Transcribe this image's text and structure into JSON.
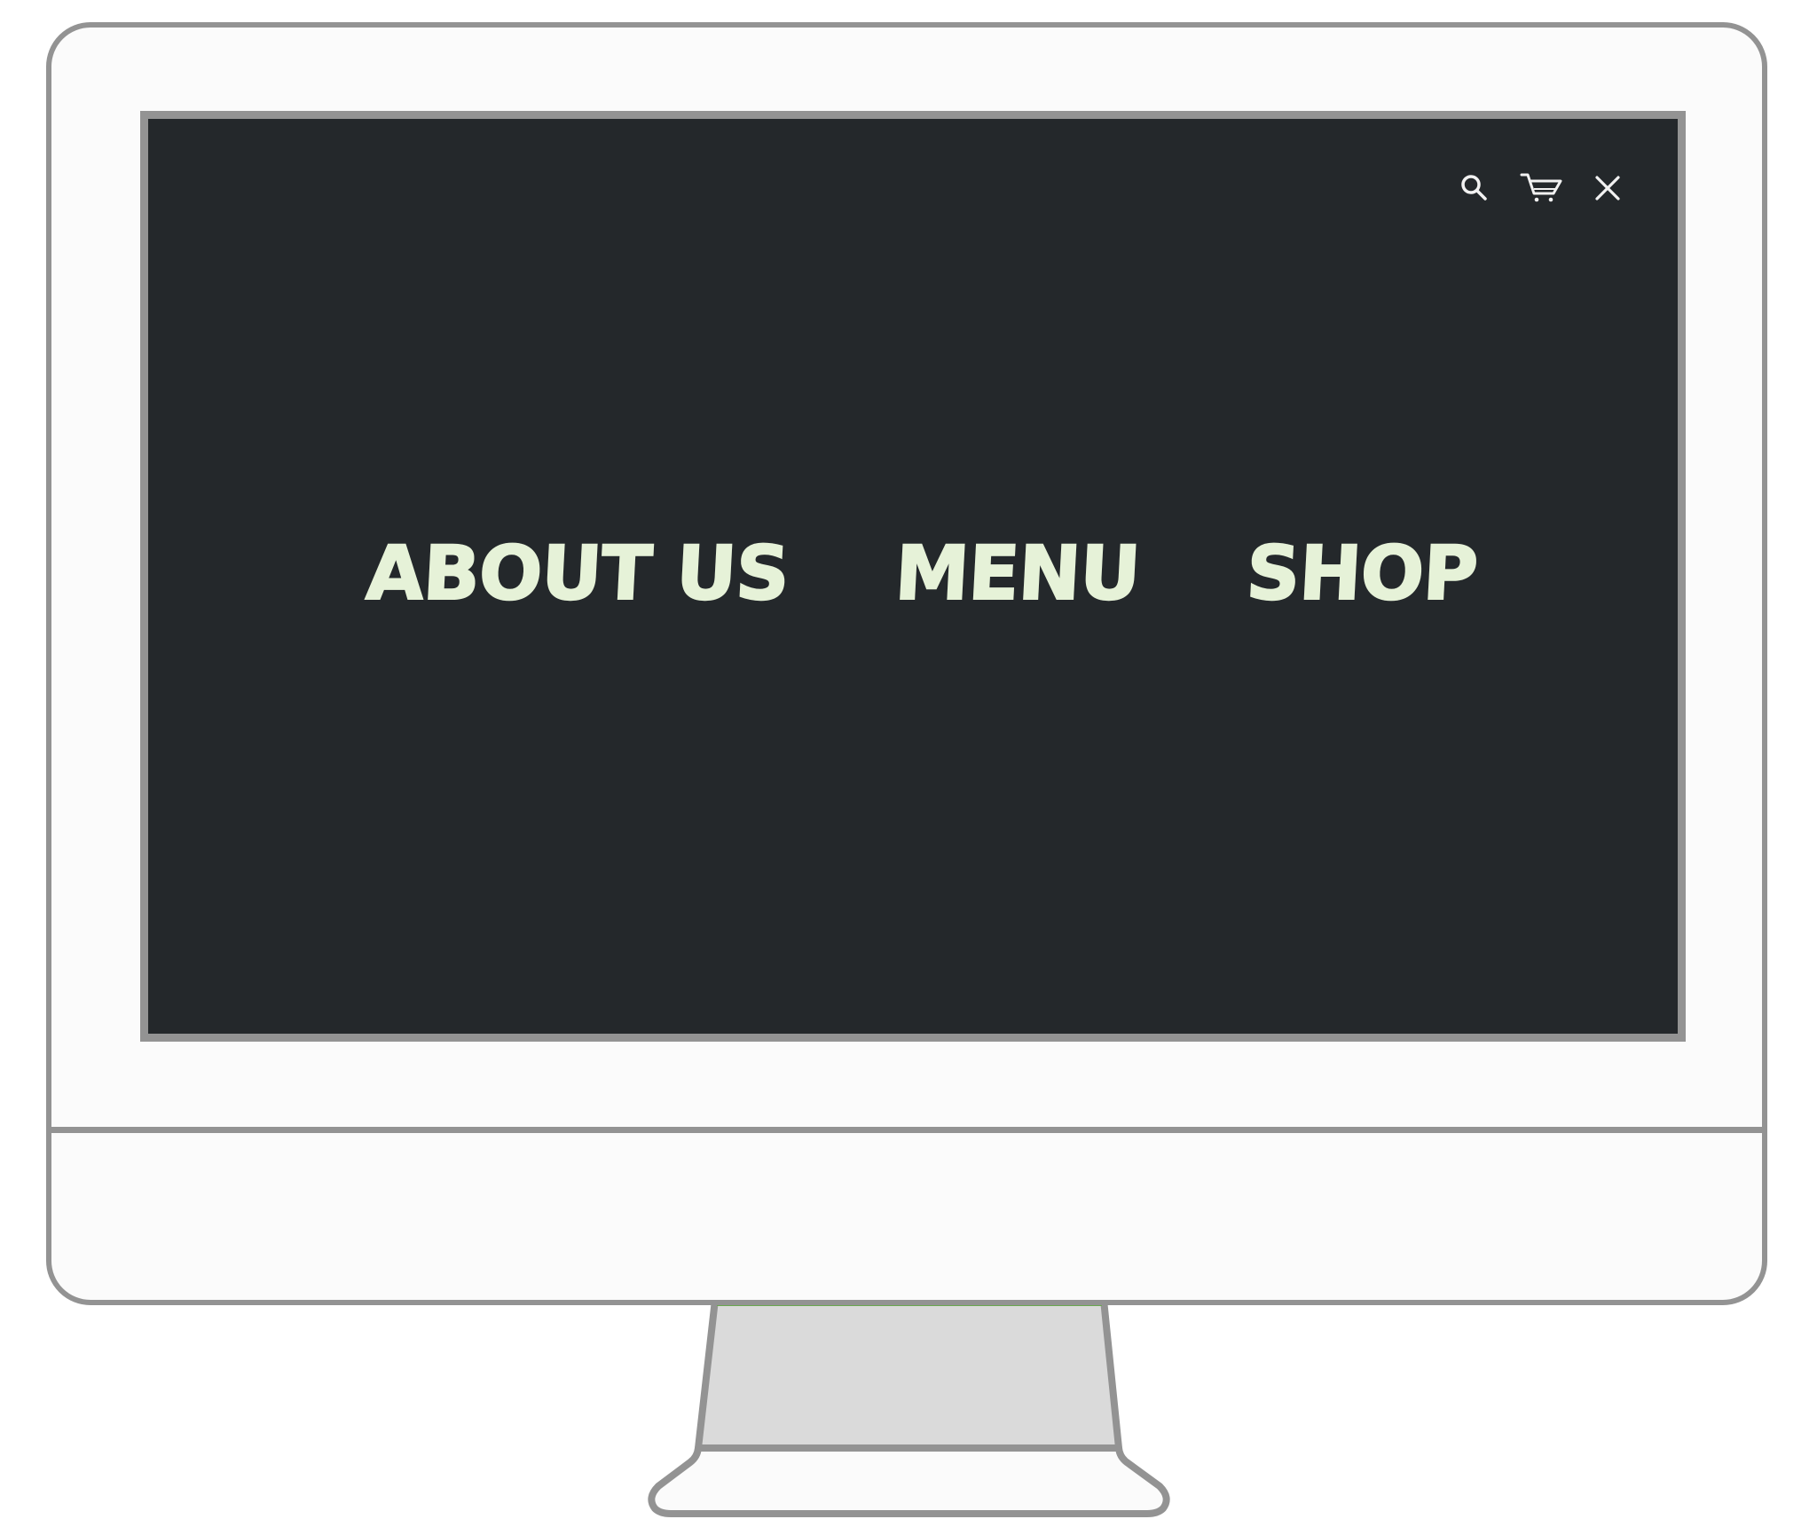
{
  "menu": {
    "items": [
      {
        "label": "ABOUT US"
      },
      {
        "label": "MENU"
      },
      {
        "label": "SHOP"
      }
    ]
  },
  "toolbar": {
    "icons": [
      "search-icon",
      "cart-icon",
      "close-icon"
    ]
  },
  "colors": {
    "screen_background": "#24282b",
    "menu_text": "#e6f2d8",
    "icon_color": "#f2f2f2",
    "bezel": "#fbfbfb",
    "outline": "#939393",
    "stand_neck": "#dadada",
    "accent_line": "#6aa84f"
  }
}
